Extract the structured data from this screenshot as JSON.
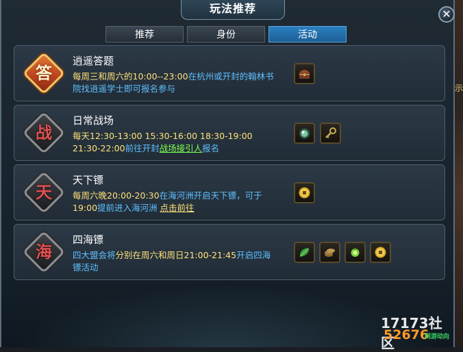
{
  "window": {
    "title": "玩法推荐",
    "close_icon": "close-icon"
  },
  "tabs": [
    {
      "label": "推荐",
      "active": false
    },
    {
      "label": "身份",
      "active": false
    },
    {
      "label": "活动",
      "active": true
    }
  ],
  "activities": [
    {
      "badge": "答",
      "badge_style": "gold",
      "title": "逍遥答题",
      "desc": [
        {
          "text": "每周三和周六的10:00--23:00",
          "style": "hl"
        },
        {
          "text": "在杭州或开封的翰林书院找逍遥学士即可报名参与",
          "style": ""
        }
      ],
      "rewards": [
        "treasure-chest-icon"
      ]
    },
    {
      "badge": "战",
      "badge_style": "dark",
      "title": "日常战场",
      "desc": [
        {
          "text": "每天12:30-13:00 15:30-16:00 18:30-19:00 21:30-22:00",
          "style": "hl"
        },
        {
          "text": "前往开封",
          "style": ""
        },
        {
          "text": "战场接引人",
          "style": "lnk"
        },
        {
          "text": "报名",
          "style": ""
        }
      ],
      "rewards": [
        "jade-orb-icon",
        "key-icon"
      ]
    },
    {
      "badge": "天",
      "badge_style": "dark",
      "title": "天下镖",
      "desc": [
        {
          "text": "每周六晚20:00-20:30",
          "style": "hl"
        },
        {
          "text": "在海河洲开启天下镖，可于",
          "style": ""
        },
        {
          "text": "19:00",
          "style": "hl"
        },
        {
          "text": "提前进入海河洲 ",
          "style": ""
        },
        {
          "text": "点击前往",
          "style": "lnk-y"
        }
      ],
      "rewards": [
        "gold-coin-icon"
      ]
    },
    {
      "badge": "海",
      "badge_style": "dark",
      "title": "四海镖",
      "desc": [
        {
          "text": "四大盟会将",
          "style": ""
        },
        {
          "text": "分别在周六和周日21:00-21:45",
          "style": "hl"
        },
        {
          "text": "开启四海镖活动",
          "style": ""
        }
      ],
      "rewards": [
        "green-leaf-icon",
        "coin-stack-icon",
        "green-herb-icon",
        "gold-coin-icon"
      ]
    }
  ],
  "watermark": {
    "line1": "17173社区",
    "line2": "52676",
    "line3": "网游动向"
  },
  "colors": {
    "highlight": "#ffe27a",
    "desc": "#5ec0ff",
    "link": "#7dff52",
    "tab_active": "#2a7fc0"
  }
}
